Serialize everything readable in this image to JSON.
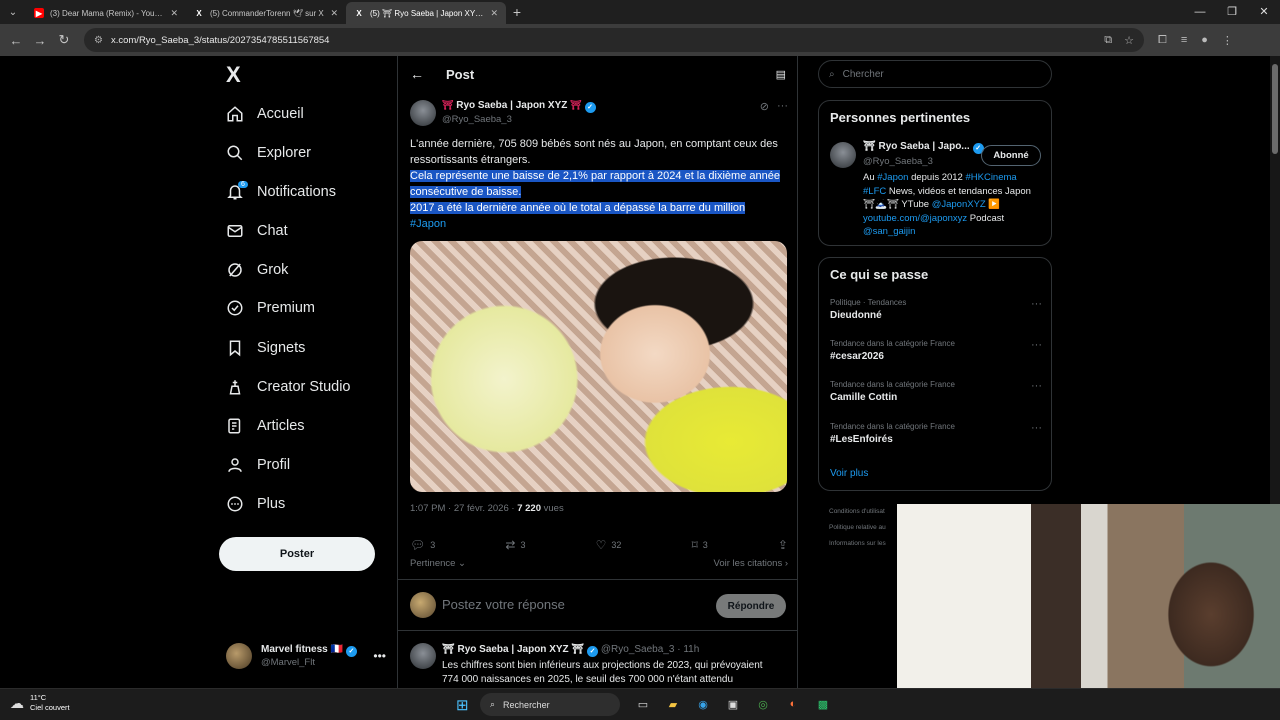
{
  "browser": {
    "tabs": [
      {
        "title": "(3) Dear Mama (Remix) - YouTube",
        "icon": "youtube-icon",
        "active": false
      },
      {
        "title": "(5) CommanderTorenn 🕊 sur X",
        "icon": "x-icon",
        "active": false
      },
      {
        "title": "(5) ⛩ Ryo Saeba | Japon XYZ ⛩",
        "icon": "x-icon",
        "active": true
      }
    ],
    "url": "x.com/Ryo_Saeba_3/status/2027354785511567854"
  },
  "sidebar": {
    "logo": "X",
    "items": [
      {
        "label": "Accueil",
        "icon": "home-icon"
      },
      {
        "label": "Explorer",
        "icon": "search-icon"
      },
      {
        "label": "Notifications",
        "icon": "bell-icon",
        "badge": "6"
      },
      {
        "label": "Chat",
        "icon": "mail-icon"
      },
      {
        "label": "Grok",
        "icon": "grok-icon"
      },
      {
        "label": "Premium",
        "icon": "premium-icon"
      },
      {
        "label": "Signets",
        "icon": "bookmark-icon"
      },
      {
        "label": "Creator Studio",
        "icon": "creator-icon"
      },
      {
        "label": "Articles",
        "icon": "articles-icon"
      },
      {
        "label": "Profil",
        "icon": "profile-icon"
      },
      {
        "label": "Plus",
        "icon": "more-circle-icon"
      }
    ],
    "post_button": "Poster",
    "account": {
      "name": "Marvel fitness 🇫🇷",
      "handle": "@Marvel_Flt"
    }
  },
  "main": {
    "title": "Post",
    "tweet": {
      "name": "Ryo Saeba | Japon XYZ",
      "handle": "@Ryo_Saeba_3",
      "line1": "L'année dernière, 705 809 bébés sont nés au Japon, en comptant ceux des ressortissants étrangers.",
      "line2": "Cela représente une baisse de 2,1% par rapport à 2024 et la dixième année consécutive de baisse.",
      "line3": "2017 a été la dernière année où le total a dépassé la barre du million",
      "hashtag": "#Japon",
      "time": "1:07 PM · 27 févr. 2026 · ",
      "views_count": "7 220",
      "views_label": " vues",
      "replies": "3",
      "reposts": "3",
      "likes": "32",
      "bookmarks": "3"
    },
    "sort_label": "Pertinence ⌄",
    "quotes_label": "Voir les citations ›",
    "reply_placeholder": "Postez votre réponse",
    "reply_button": "Répondre",
    "reply2": {
      "name": "⛩ Ryo Saeba | Japon XYZ ⛩",
      "handle": "@Ryo_Saeba_3 · 11h",
      "text": "Les chiffres sont bien inférieurs aux projections de 2023, qui prévoyaient 774 000 naissances en 2025, le seuil des 700 000 n'étant attendu"
    }
  },
  "right": {
    "search_placeholder": "Chercher",
    "relevant_title": "Personnes pertinentes",
    "relevant": {
      "name": "⛩ Ryo Saeba | Japo...",
      "handle": "@Ryo_Saeba_3",
      "follow_label": "Abonné",
      "bio_p1": "Au ",
      "bio_l1": "#Japon",
      "bio_p2": " depuis 2012 ",
      "bio_l2": "#HKCinema",
      "bio_l3": "#LFC",
      "bio_p3": " News, vidéos et tendances Japon ⛩🗻⛩ YTube ",
      "bio_l4": "@JaponXYZ",
      "bio_p4": " ▶️ ",
      "bio_l5": "youtube.com/@japonxyz",
      "bio_p5": " Podcast ",
      "bio_l6": "@san_gaijin"
    },
    "trends_title": "Ce qui se passe",
    "trends": [
      {
        "category": "Politique · Tendances",
        "name": "Dieudonné"
      },
      {
        "category": "Tendance dans la catégorie France",
        "name": "#cesar2026"
      },
      {
        "category": "Tendance dans la catégorie France",
        "name": "Camille Cottin"
      },
      {
        "category": "Tendance dans la catégorie France",
        "name": "#LesEnfoirés"
      }
    ],
    "see_more": "Voir plus",
    "footer": [
      "Conditions d'utilisat",
      "Politique relative au",
      "Informations sur les"
    ]
  },
  "taskbar": {
    "temp": "11°C",
    "weather": "Ciel couvert",
    "search": "Rechercher"
  }
}
